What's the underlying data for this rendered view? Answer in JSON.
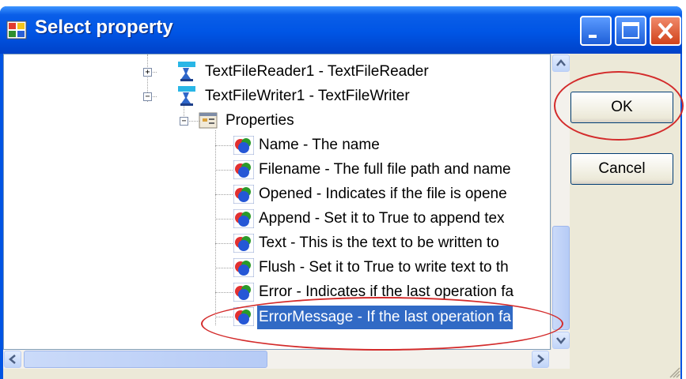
{
  "window": {
    "title": "Select property"
  },
  "tree": {
    "nodes": [
      {
        "label": "TextFileReader1 - TextFileReader",
        "expander": "+"
      },
      {
        "label": "TextFileWriter1 - TextFileWriter",
        "expander": "−"
      },
      {
        "label": "Properties",
        "expander": "−"
      },
      {
        "label": "Name - The name"
      },
      {
        "label": "Filename - The full file path and name"
      },
      {
        "label": "Opened - Indicates if the file is opene"
      },
      {
        "label": "Append - Set it to True to append tex"
      },
      {
        "label": "Text - This is the text to be written to"
      },
      {
        "label": "Flush - Set it to True to write text to th"
      },
      {
        "label": "Error - Indicates if the last operation fa"
      },
      {
        "label": "ErrorMessage - If the last operation fa",
        "selected": true
      }
    ]
  },
  "buttons": {
    "ok": "OK",
    "cancel": "Cancel"
  },
  "icons": {
    "app": "application-icon",
    "component": "component-icon",
    "properties": "properties-icon",
    "property": "property-icon"
  }
}
